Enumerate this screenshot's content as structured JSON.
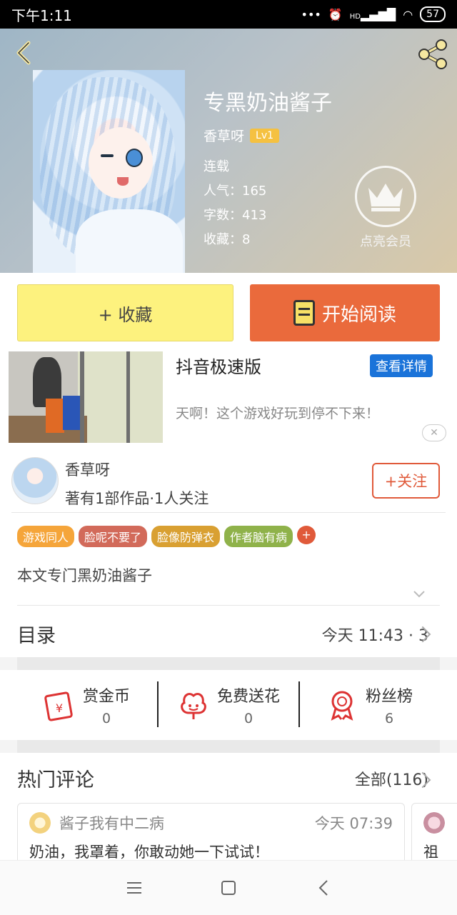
{
  "status_bar": {
    "time": "下午1:11",
    "signal_label": "HD",
    "battery": "57"
  },
  "book": {
    "title": "专黑奶油酱子",
    "author": "香草呀",
    "level": "Lv1",
    "status": "连载",
    "popularity": "人气：165",
    "word_count": "字数：413",
    "favorites": "收藏：8",
    "vip_label": "点亮会员"
  },
  "actions": {
    "collect_label": "+ 收藏",
    "read_label": "开始阅读"
  },
  "ad": {
    "title": "抖音极速版",
    "detail_label": "查看详情",
    "description": "天啊！这个游戏好玩到停不下来！",
    "close_label": "✕"
  },
  "author_panel": {
    "name": "香草呀",
    "works": "著有1部作品·1人关注",
    "follow_label": "+关注"
  },
  "tags": [
    {
      "label": "游戏同人",
      "color": "#f5a53a"
    },
    {
      "label": "脸呢不要了",
      "color": "#d26a5a"
    },
    {
      "label": "脸像防弹衣",
      "color": "#d9a032"
    },
    {
      "label": "作者脑有病",
      "color": "#8fb24a"
    }
  ],
  "tag_more": "+",
  "summary": "本文专门黑奶油酱子",
  "toc": {
    "label": "目录",
    "info": "今天 11:43 · 3"
  },
  "stats": [
    {
      "label": "赏金币",
      "value": "0"
    },
    {
      "label": "免费送花",
      "value": "0"
    },
    {
      "label": "粉丝榜",
      "value": "6"
    }
  ],
  "comments": {
    "header": "热门评论",
    "all_label": "全部(116)",
    "items": [
      {
        "user": "酱子我有中二病",
        "time": "今天 07:39",
        "text": "奶油，我罩着，你敢动她一下试试！"
      },
      {
        "text": "祖"
      }
    ]
  },
  "colors": {
    "accent": "#e05a3a",
    "read_button": "#ea6a3c",
    "collect_button": "#fdf27e",
    "ad_button": "#1a73d9"
  }
}
